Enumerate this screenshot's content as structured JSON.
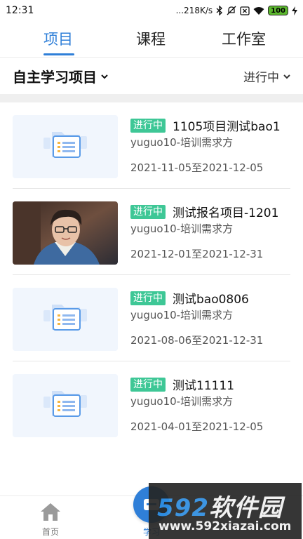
{
  "status_bar": {
    "time": "12:31",
    "network_speed": "...218K/s",
    "battery": "100",
    "icons": [
      "bluetooth-icon",
      "mute-icon",
      "close-box-icon",
      "wifi-icon",
      "battery-icon",
      "charging-icon"
    ]
  },
  "tabs": [
    {
      "label": "项目",
      "active": true
    },
    {
      "label": "课程",
      "active": false
    },
    {
      "label": "工作室",
      "active": false
    }
  ],
  "filter": {
    "category": "自主学习项目",
    "status": "进行中"
  },
  "colors": {
    "accent": "#2f7fd8",
    "badge": "#3ec796"
  },
  "projects": [
    {
      "status": "进行中",
      "title": "1105项目测试bao1",
      "org": "yuguo10-培训需求方",
      "dates": "2021-11-05至2021-12-05",
      "thumb": "folder-placeholder"
    },
    {
      "status": "进行中",
      "title": "测试报名项目-1201",
      "org": "yuguo10-培训需求方",
      "dates": "2021-12-01至2021-12-31",
      "thumb": "person-photo"
    },
    {
      "status": "进行中",
      "title": "测试bao0806",
      "org": "yuguo10-培训需求方",
      "dates": "2021-08-06至2021-12-31",
      "thumb": "folder-placeholder"
    },
    {
      "status": "进行中",
      "title": "测试11111",
      "org": "yuguo10-培训需求方",
      "dates": "2021-04-01至2021-12-05",
      "thumb": "folder-placeholder"
    }
  ],
  "bottom_nav": {
    "home": "首页",
    "study": "学习"
  },
  "watermark": {
    "logo_num": "592",
    "logo_text": "软件园",
    "url": "www.592xiazai.com"
  }
}
